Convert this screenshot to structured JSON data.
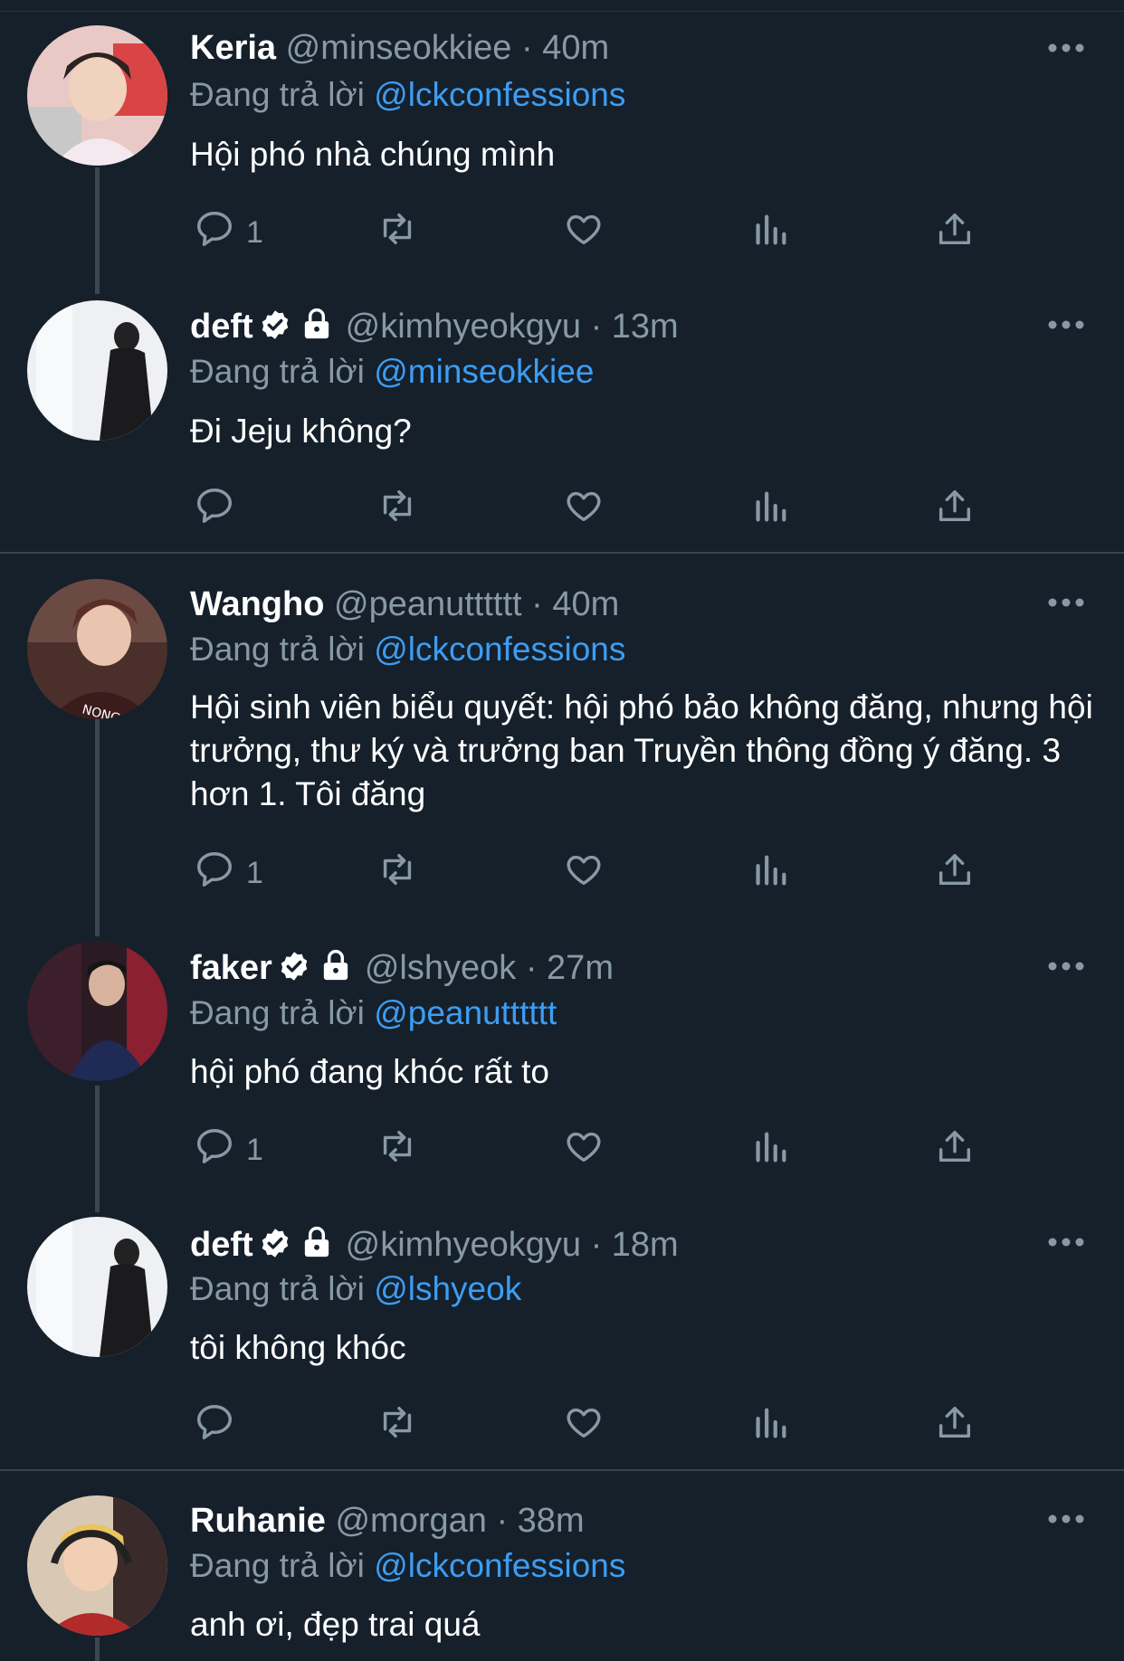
{
  "replying_prefix": "Đang trả lời",
  "colors": {
    "background": "#15202b",
    "accent": "#3d9df2",
    "muted": "#8899a6"
  },
  "tweets": [
    {
      "name": "Keria",
      "handle": "@minseokkiee",
      "time": "40m",
      "verified": false,
      "protected": false,
      "reply_to": "@lckconfessions",
      "text": "Hội phó nhà chúng mình",
      "reply_count": "1"
    },
    {
      "name": "deft",
      "handle": "@kimhyeokgyu",
      "time": "13m",
      "verified": true,
      "protected": true,
      "reply_to": "@minseokkiee",
      "text": "Đi Jeju không?",
      "reply_count": ""
    },
    {
      "name": "Wangho",
      "handle": "@peanutttttt",
      "time": "40m",
      "verified": false,
      "protected": false,
      "reply_to": "@lckconfessions",
      "text": "Hội sinh viên biểu quyết: hội phó bảo không đăng, nhưng hội trưởng, thư ký và trưởng ban Truyền thông đồng ý đăng. 3 hơn 1. Tôi đăng",
      "reply_count": "1"
    },
    {
      "name": "faker",
      "handle": "@lshyeok",
      "time": "27m",
      "verified": true,
      "protected": true,
      "reply_to": "@peanutttttt",
      "text": "hội phó đang khóc rất to",
      "reply_count": "1"
    },
    {
      "name": "deft",
      "handle": "@kimhyeokgyu",
      "time": "18m",
      "verified": true,
      "protected": true,
      "reply_to": "@lshyeok",
      "text": "tôi không khóc",
      "reply_count": ""
    },
    {
      "name": "Ruhanie",
      "handle": "@morgan",
      "time": "38m",
      "verified": false,
      "protected": false,
      "reply_to": "@lckconfessions",
      "text": "anh ơi, đẹp trai quá",
      "reply_count": ""
    }
  ]
}
